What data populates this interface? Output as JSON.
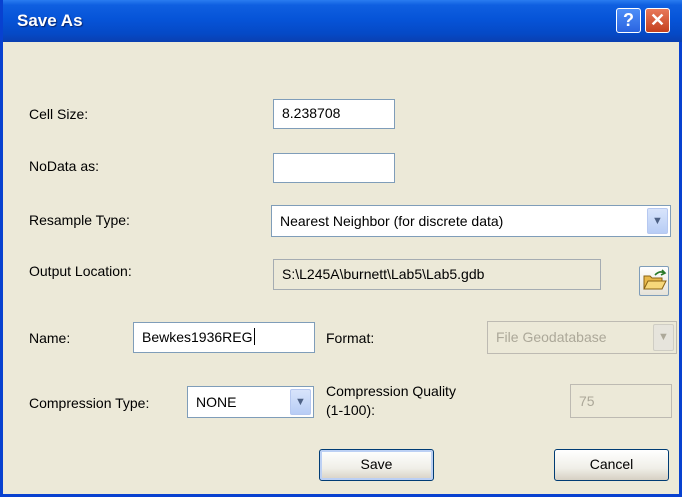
{
  "window": {
    "title": "Save As",
    "help_label": "?",
    "close_label": "✕"
  },
  "cell_size": {
    "label": "Cell Size:",
    "value": "8.238708"
  },
  "nodata": {
    "label": "NoData as:",
    "value": ""
  },
  "resample": {
    "label": "Resample Type:",
    "value": "Nearest Neighbor (for discrete data)"
  },
  "output_location": {
    "label": "Output Location:",
    "value": "S:\\L245A\\burnett\\Lab5\\Lab5.gdb"
  },
  "name": {
    "label": "Name:",
    "value": "Bewkes1936REG"
  },
  "format": {
    "label": "Format:",
    "value": "File Geodatabase"
  },
  "compression_type": {
    "label": "Compression Type:",
    "value": "NONE"
  },
  "compression_quality": {
    "label_line1": "Compression Quality",
    "label_line2": "(1-100):",
    "value": "75"
  },
  "buttons": {
    "save": "Save",
    "cancel": "Cancel"
  },
  "icons": {
    "dropdown": "chevron-down-icon",
    "folder": "open-folder-icon",
    "help": "help-icon",
    "close": "close-icon"
  }
}
